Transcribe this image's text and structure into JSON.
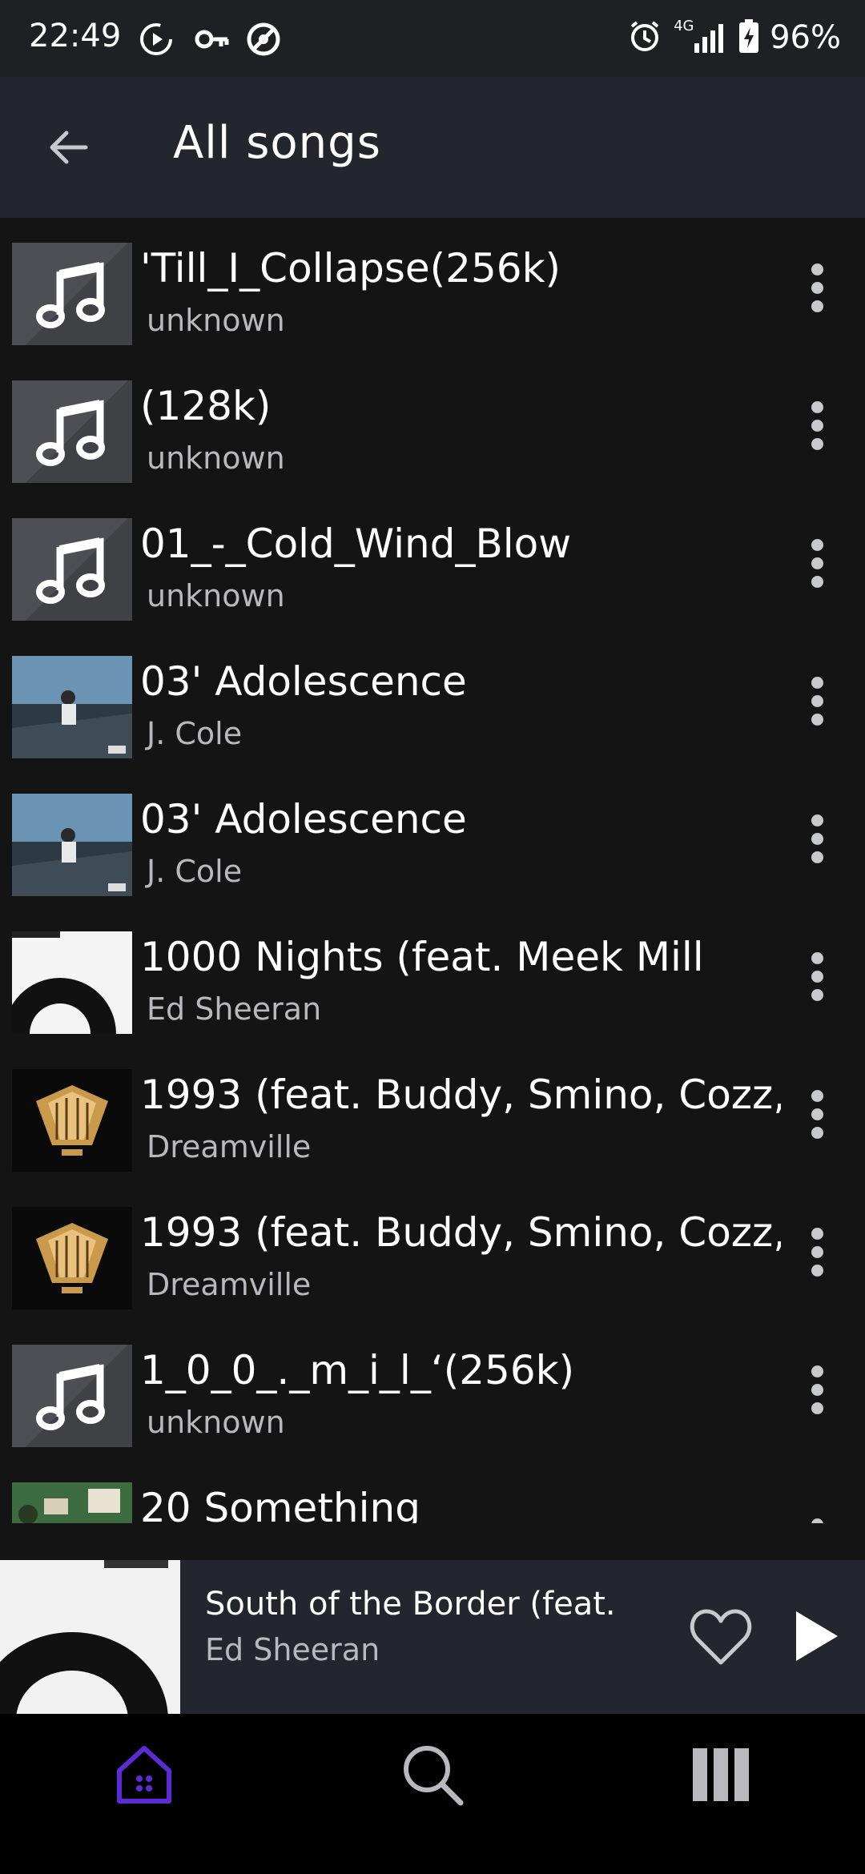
{
  "status_bar": {
    "time": "22:49",
    "network": "4G",
    "battery": "96%",
    "icons": [
      "replay-icon",
      "key-icon",
      "data-saver-icon",
      "alarm-icon",
      "signal-icon",
      "battery-charging-icon"
    ]
  },
  "app_bar": {
    "back_icon": "arrow-left-icon",
    "title": "All songs"
  },
  "songs": [
    {
      "title": "'Till_I_Collapse(256k)",
      "artist": "unknown",
      "art": "placeholder"
    },
    {
      "title": "(128k)",
      "artist": "unknown",
      "art": "placeholder"
    },
    {
      "title": "01_-_Cold_Wind_Blow",
      "artist": "unknown",
      "art": "placeholder"
    },
    {
      "title": "03' Adolescence",
      "artist": "J. Cole",
      "art": "album-cover"
    },
    {
      "title": "03' Adolescence",
      "artist": "J. Cole",
      "art": "album-cover"
    },
    {
      "title": "1000 Nights (feat. Meek Mill",
      "artist": "Ed Sheeran",
      "art": "album-cover"
    },
    {
      "title": "1993 (feat. Buddy, Smino, Cozz,",
      "artist": "Dreamville",
      "art": "album-cover"
    },
    {
      "title": "1993 (feat. Buddy, Smino, Cozz,",
      "artist": "Dreamville",
      "art": "album-cover"
    },
    {
      "title": "1_0_0_._m_i_l_‘(256k)",
      "artist": "unknown",
      "art": "placeholder"
    },
    {
      "title": "20 Something",
      "artist": "",
      "art": "album-cover"
    }
  ],
  "now_playing": {
    "title": "South of the Border (feat.",
    "artist": "Ed Sheeran",
    "favorite_icon": "heart-outline-icon",
    "play_icon": "play-icon"
  },
  "bottom_nav": {
    "items": [
      {
        "name": "home",
        "icon": "home-icon",
        "active": true
      },
      {
        "name": "search",
        "icon": "search-icon",
        "active": false
      },
      {
        "name": "library",
        "icon": "library-icon",
        "active": false
      }
    ]
  },
  "colors": {
    "background": "#141414",
    "app_bar": "#23262d",
    "secondary_text": "#b9b9bd",
    "accent": "#5b2bd6"
  }
}
